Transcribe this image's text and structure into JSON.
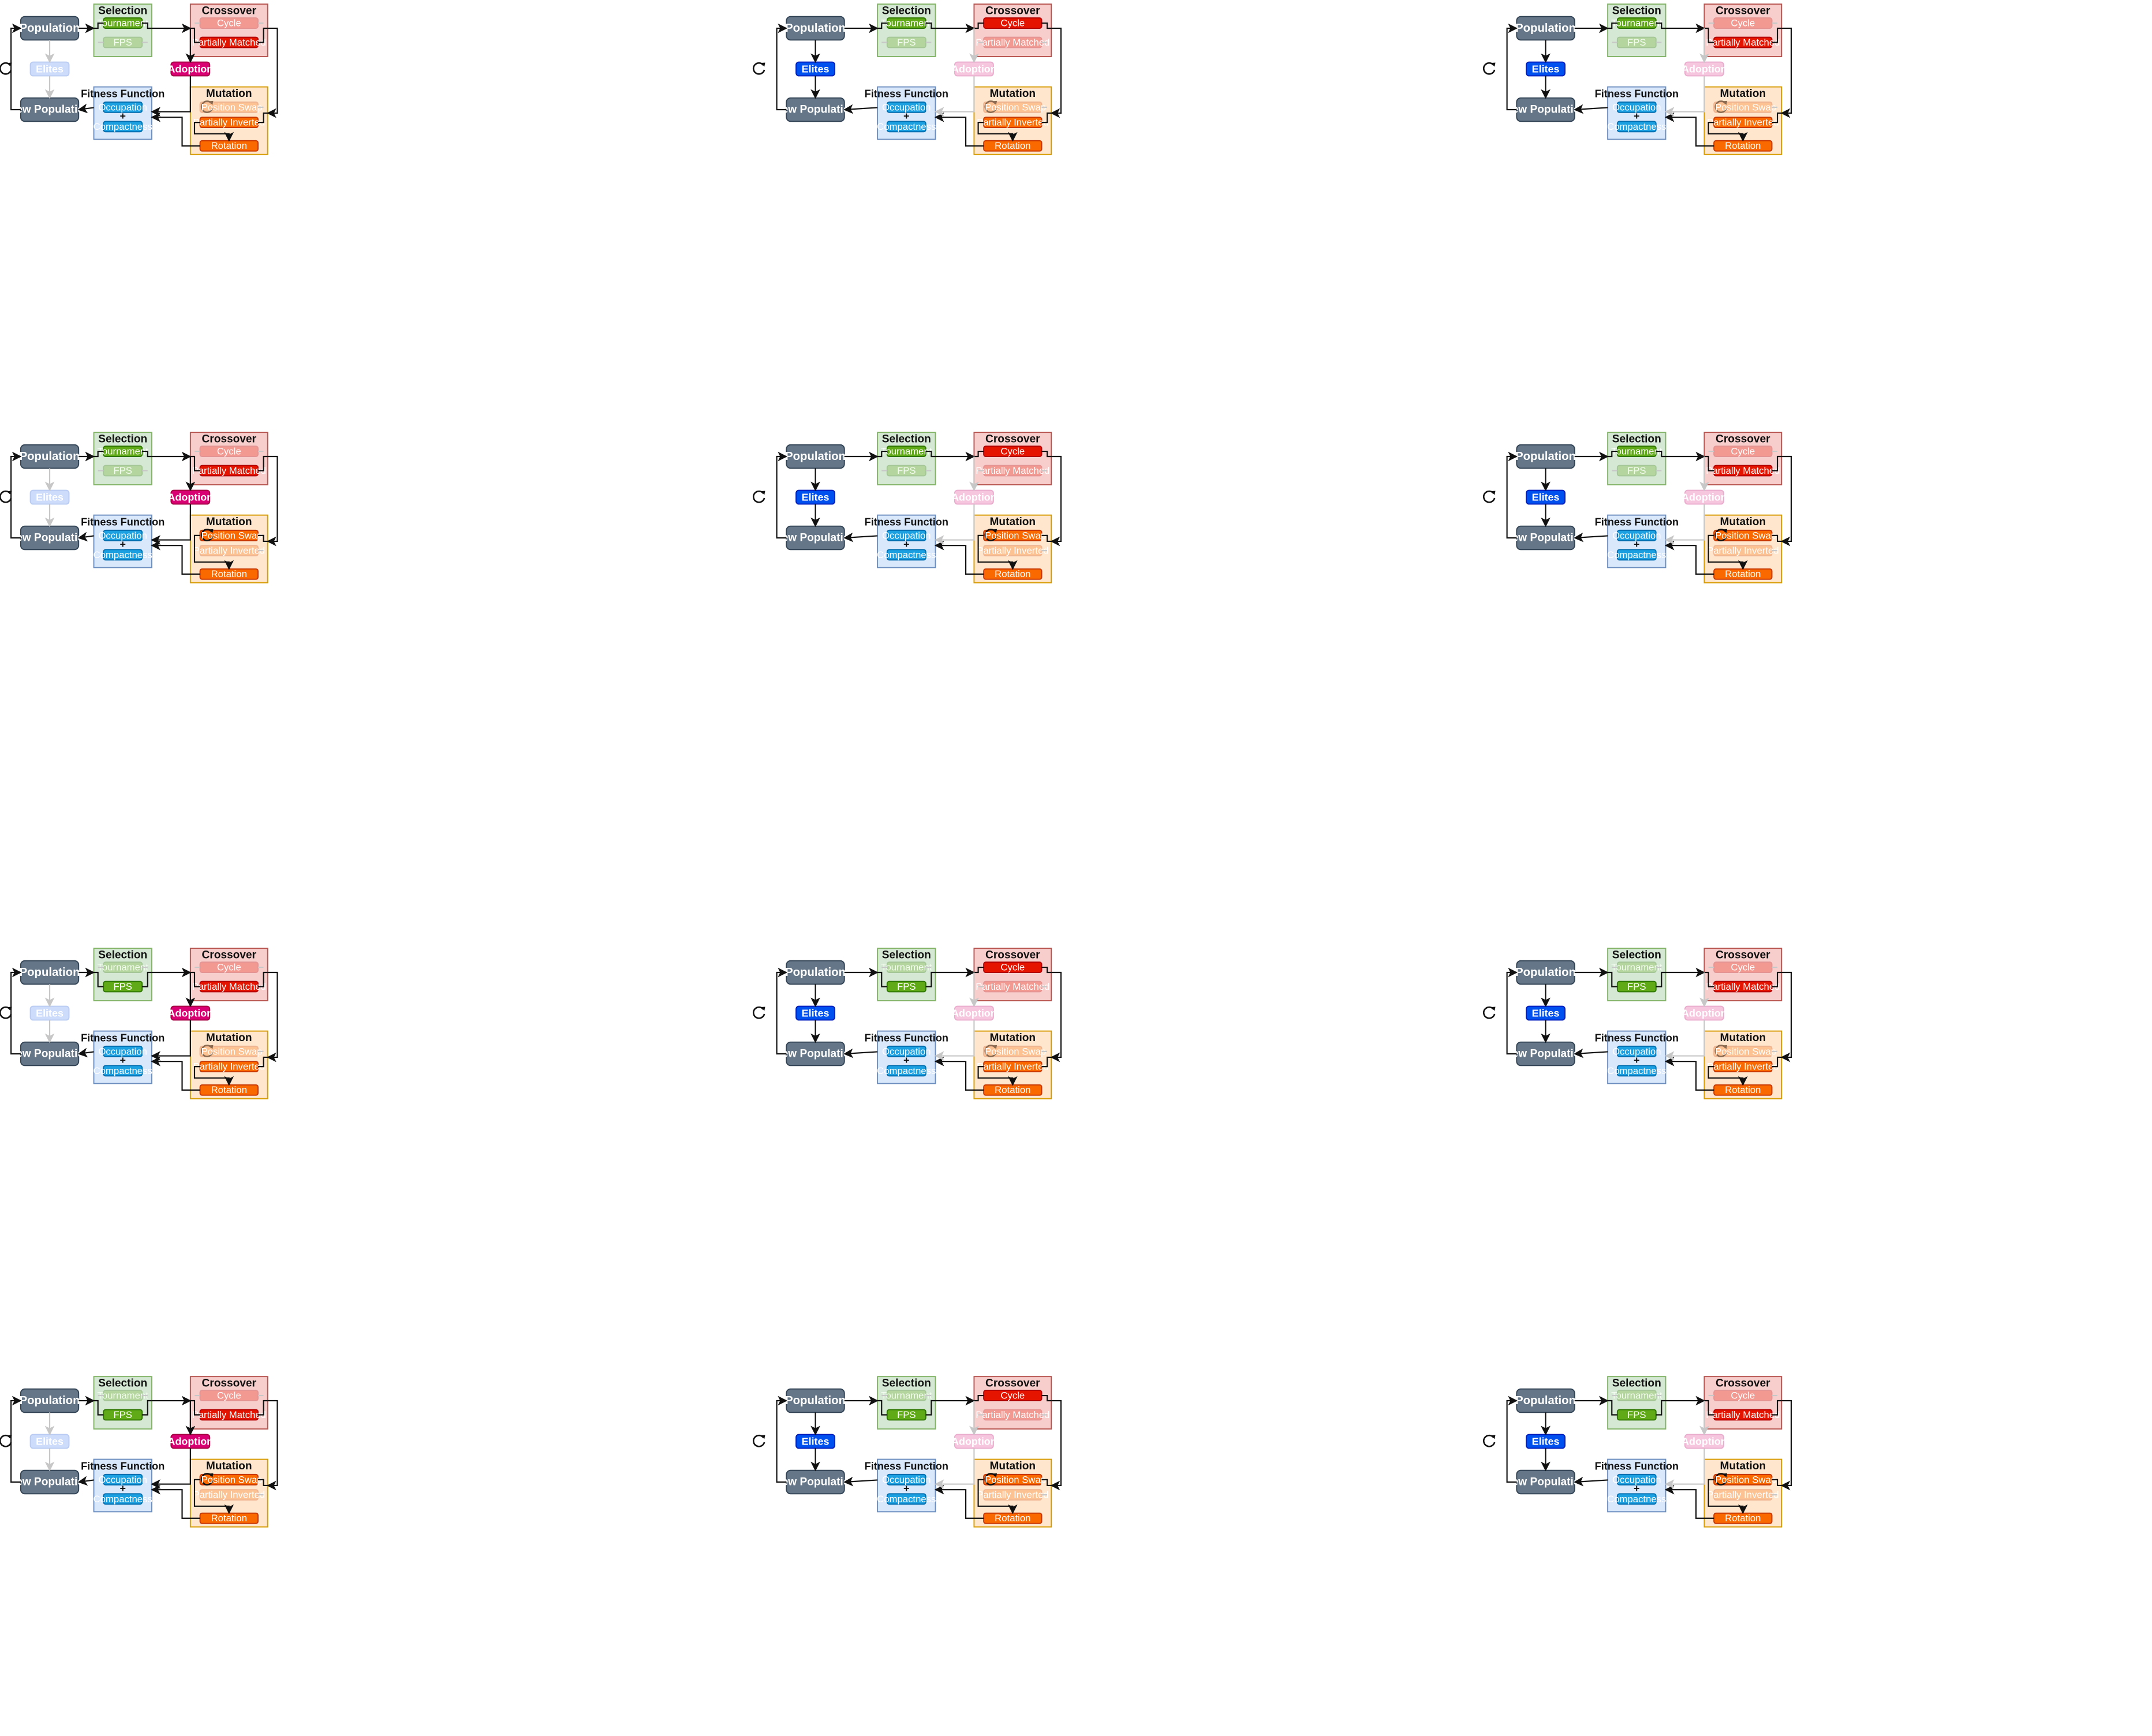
{
  "labels": {
    "population": "Population",
    "elites": "Elites",
    "new_population": "New Population",
    "selection": "Selection",
    "tournament": "Tournament",
    "fps": "FPS",
    "crossover": "Crossover",
    "cycle": "Cycle",
    "partially_matched": "Partially Matched",
    "adoption": "Adoption",
    "fitness_function": "Fitness Function",
    "occupation": "Occupation",
    "plus": "+",
    "compactness": "Compactness",
    "mutation": "Mutation",
    "position_swap": "Position Swap",
    "partially_inverted": "Partially Inverted",
    "rotation": "Rotation"
  },
  "panels": [
    {
      "id": "r1c1",
      "elites": false,
      "adoption": true,
      "selection": "Tournament",
      "crossover": "Partially Matched",
      "mutation": "Partially Inverted"
    },
    {
      "id": "r1c2",
      "elites": true,
      "adoption": false,
      "selection": "Tournament",
      "crossover": "Cycle",
      "mutation": "Partially Inverted"
    },
    {
      "id": "r1c3",
      "elites": true,
      "adoption": false,
      "selection": "Tournament",
      "crossover": "Partially Matched",
      "mutation": "Partially Inverted"
    },
    {
      "id": "r2c1",
      "elites": false,
      "adoption": true,
      "selection": "Tournament",
      "crossover": "Partially Matched",
      "mutation": "Position Swap"
    },
    {
      "id": "r2c2",
      "elites": true,
      "adoption": false,
      "selection": "Tournament",
      "crossover": "Cycle",
      "mutation": "Position Swap"
    },
    {
      "id": "r2c3",
      "elites": true,
      "adoption": false,
      "selection": "Tournament",
      "crossover": "Partially Matched",
      "mutation": "Position Swap"
    },
    {
      "id": "r3c1",
      "elites": false,
      "adoption": true,
      "selection": "FPS",
      "crossover": "Partially Matched",
      "mutation": "Partially Inverted"
    },
    {
      "id": "r3c2",
      "elites": true,
      "adoption": false,
      "selection": "FPS",
      "crossover": "Cycle",
      "mutation": "Partially Inverted"
    },
    {
      "id": "r3c3",
      "elites": true,
      "adoption": false,
      "selection": "FPS",
      "crossover": "Partially Matched",
      "mutation": "Partially Inverted"
    },
    {
      "id": "r4c1",
      "elites": false,
      "adoption": true,
      "selection": "FPS",
      "crossover": "Partially Matched",
      "mutation": "Position Swap"
    },
    {
      "id": "r4c2",
      "elites": true,
      "adoption": false,
      "selection": "FPS",
      "crossover": "Cycle",
      "mutation": "Position Swap"
    },
    {
      "id": "r4c3",
      "elites": true,
      "adoption": false,
      "selection": "FPS",
      "crossover": "Partially Matched",
      "mutation": "Position Swap"
    }
  ],
  "icons": {
    "loop": "loop-arrow-icon",
    "position_swap": "rotate-icon"
  },
  "colors": {
    "population_fill": "#647687",
    "population_stroke": "#314354",
    "elites_active": "#0050ef",
    "elites_faded": "#cddcfb",
    "selection_bg": "#d5e8d4",
    "selection_border": "#82b366",
    "selection_item": "#60a917",
    "crossover_bg": "#f8cecc",
    "crossover_border": "#b85450",
    "crossover_item": "#e51400",
    "adoption_active": "#d80073",
    "adoption_faded": "#f6c6df",
    "fitness_bg": "#dae8fc",
    "fitness_border": "#6c8ebf",
    "fitness_item": "#1ba1e2",
    "mutation_bg": "#ffe6cc",
    "mutation_border": "#d79b00",
    "mutation_item": "#fa6800"
  }
}
